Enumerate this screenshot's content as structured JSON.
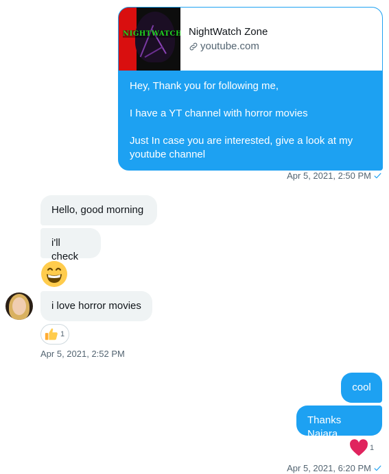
{
  "link_card": {
    "thumbnail_logo_text": "NIGHTWATCH",
    "title": "NightWatch Zone",
    "url": "youtube.com",
    "messages": [
      "Hey, Thank you for following me,",
      "I have a YT channel with horror movies",
      "Just In case you are interested, give a look at my youtube channel"
    ],
    "timestamp": "Apr 5, 2021, 2:50 PM"
  },
  "incoming": {
    "messages": [
      "Hello, good morning",
      "i'll check",
      "i love horror movies"
    ],
    "emoji_message": "grinning-face",
    "reaction": {
      "icon": "thumbs-up",
      "count": "1"
    },
    "timestamp": "Apr 5, 2021, 2:52 PM"
  },
  "outgoing": {
    "messages": [
      "cool",
      "Thanks Naiara"
    ],
    "reaction": {
      "icon": "heart",
      "count": "1"
    },
    "timestamp": "Apr 5, 2021, 6:20 PM"
  },
  "colors": {
    "accent": "#1da1f2",
    "incoming_bubble": "#eff3f4",
    "muted_text": "#536471",
    "heart": "#e0245e"
  }
}
